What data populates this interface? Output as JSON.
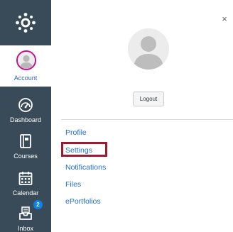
{
  "global_nav": {
    "background": "#394b58",
    "logo_icon": "canvas-logo-icon",
    "account": {
      "label": "Account",
      "avatar_border": "#c20f8e",
      "label_color": "#2d63b4"
    },
    "items": [
      {
        "label": "Dashboard",
        "icon": "dashboard-icon"
      },
      {
        "label": "Courses",
        "icon": "courses-icon"
      },
      {
        "label": "Calendar",
        "icon": "calendar-icon"
      },
      {
        "label": "Inbox",
        "icon": "inbox-icon",
        "badge": "2"
      }
    ],
    "badge_color": "#0a84ea"
  },
  "tray": {
    "close_glyph": "×",
    "close_icon": "close-icon",
    "avatar_icon": "user-avatar-icon",
    "logout_label": "Logout",
    "links": [
      {
        "label": "Profile"
      },
      {
        "label": "Settings",
        "highlighted": true
      },
      {
        "label": "Notifications"
      },
      {
        "label": "Files"
      },
      {
        "label": "ePortfolios"
      }
    ],
    "link_color": "#1e6fcf",
    "highlight_color": "#9b1c31"
  }
}
